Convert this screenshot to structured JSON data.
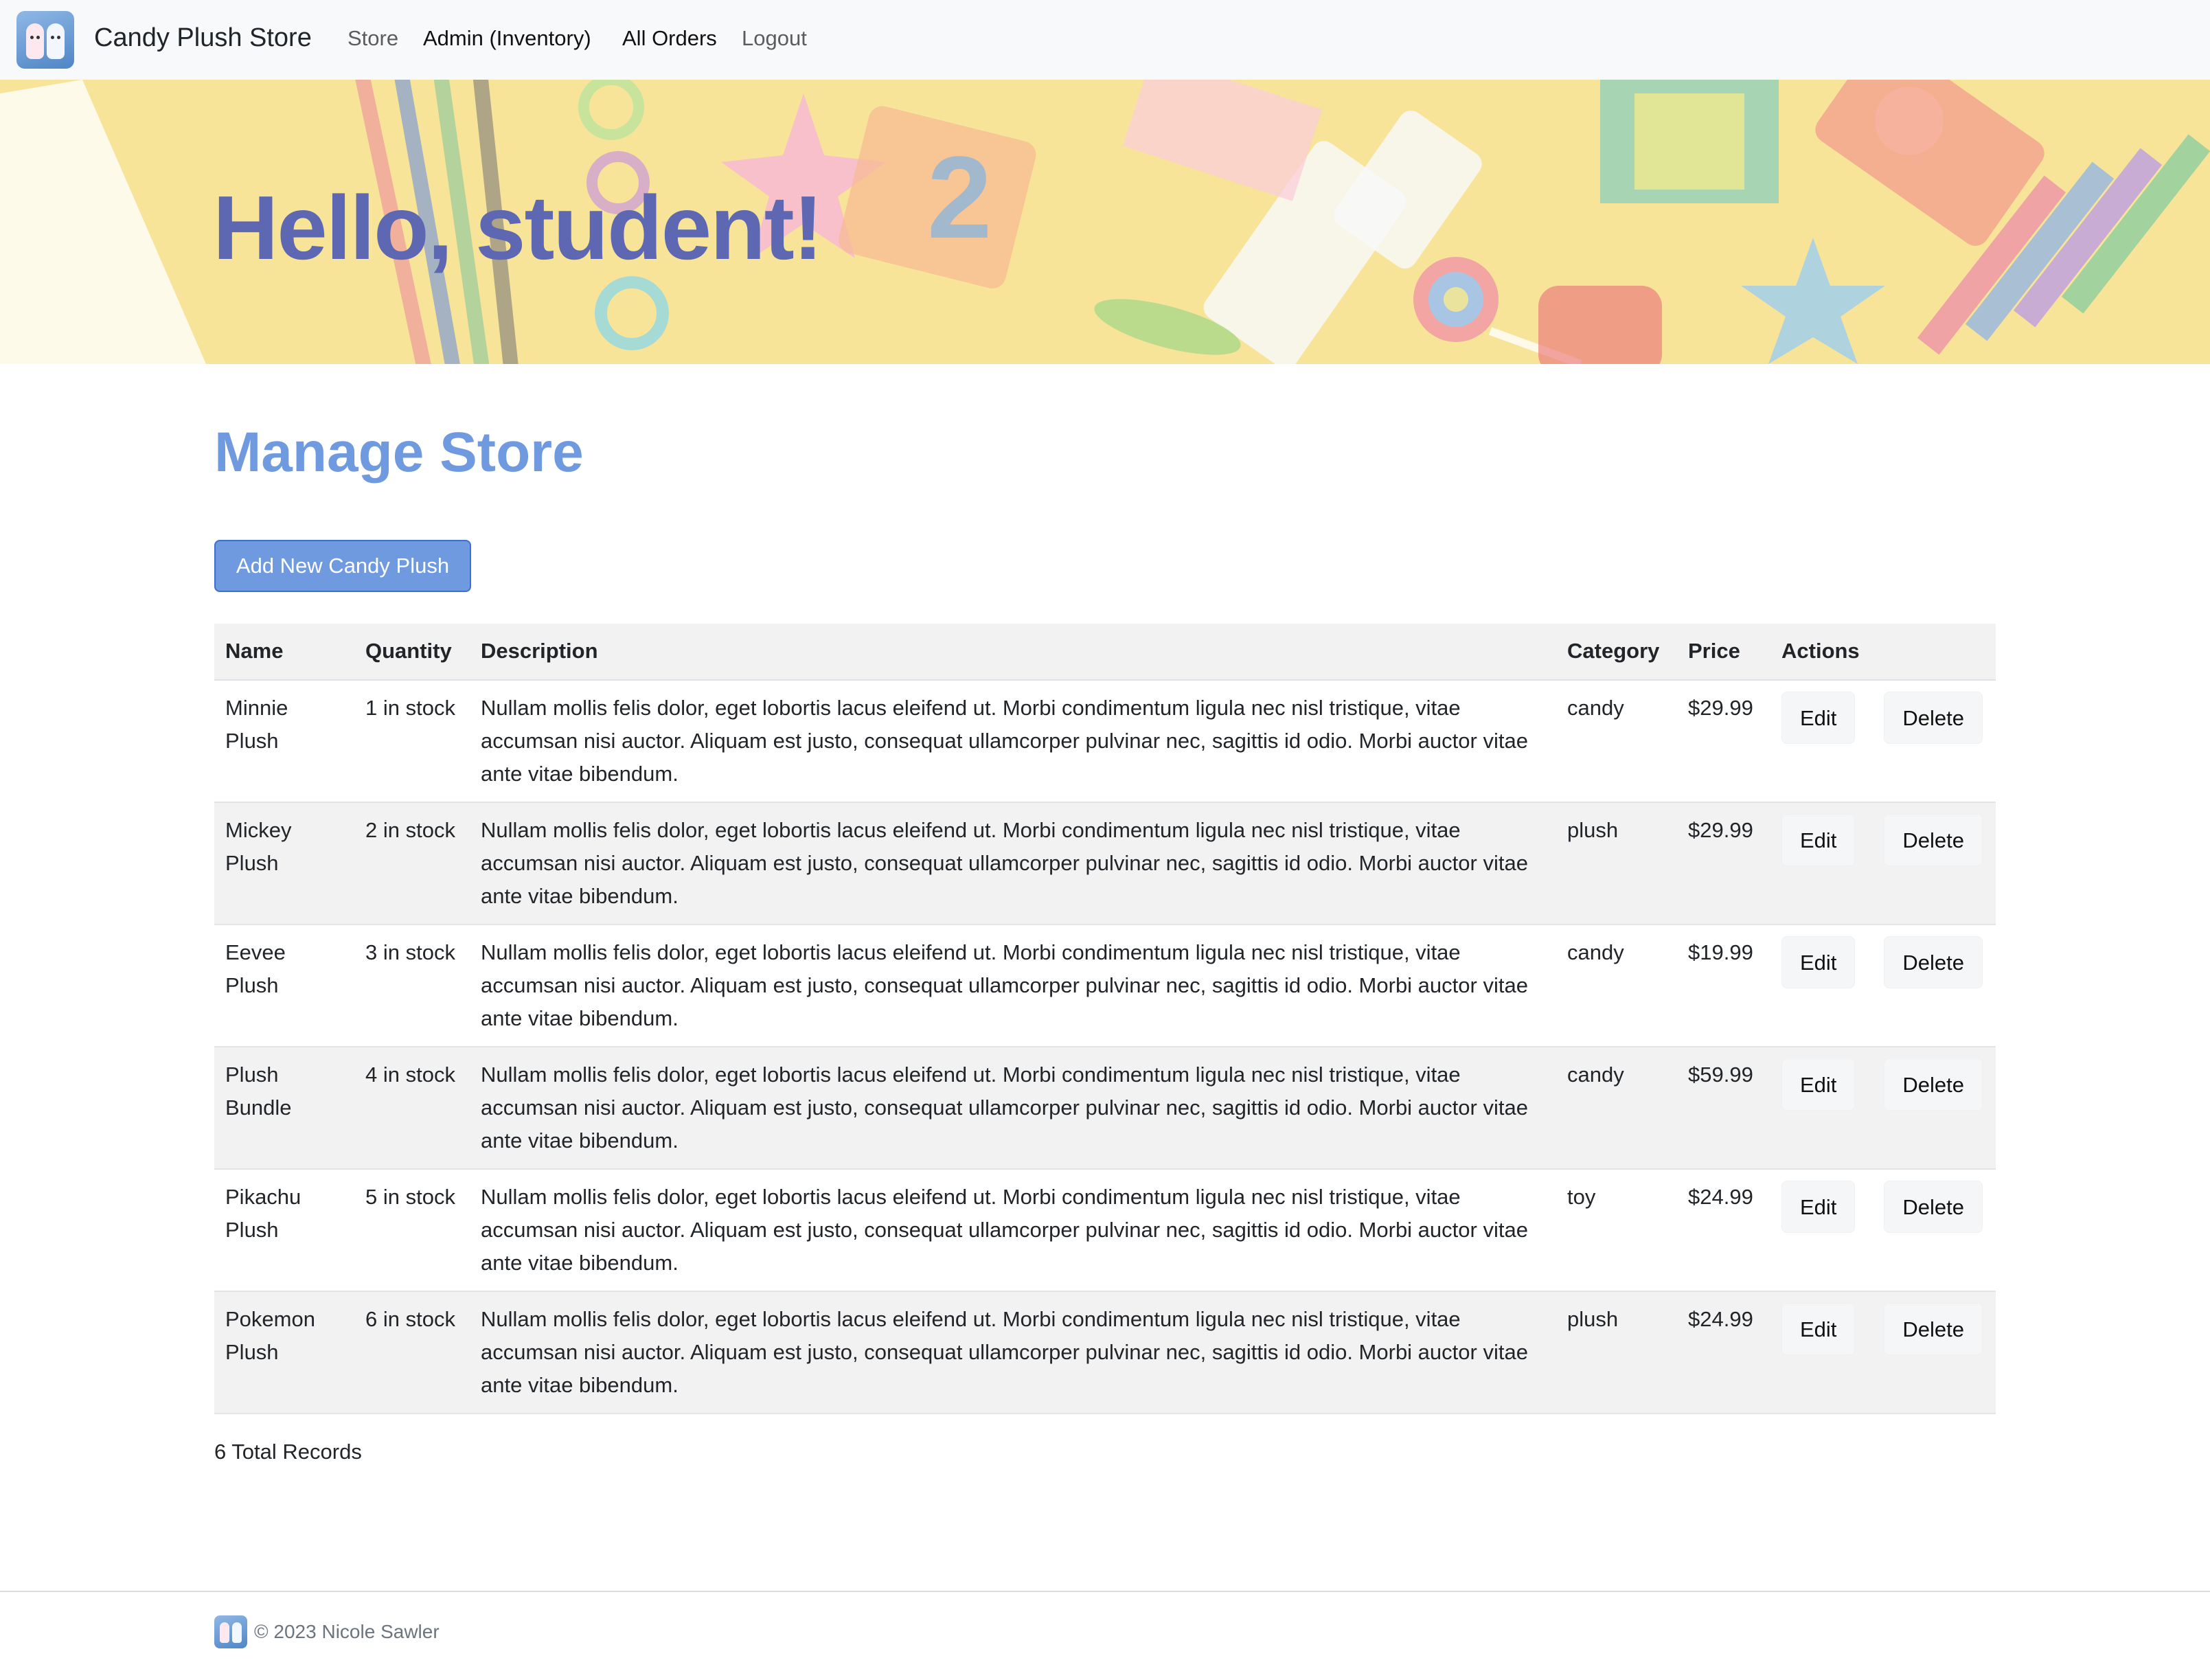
{
  "navbar": {
    "brand": "Candy Plush Store",
    "links": [
      {
        "label": "Store",
        "active": false
      },
      {
        "label": "Admin (Inventory)",
        "active": true
      },
      {
        "label": "All Orders",
        "active": true
      },
      {
        "label": "Logout",
        "active": false
      }
    ]
  },
  "hero": {
    "title": "Hello, student!"
  },
  "main": {
    "page_title": "Manage Store",
    "add_button_label": "Add New Candy Plush",
    "table": {
      "headers": [
        "Name",
        "Quantity",
        "Description",
        "Category",
        "Price",
        "Actions"
      ],
      "rows": [
        {
          "name": "Minnie Plush",
          "quantity": "1 in stock",
          "description": "Nullam mollis felis dolor, eget lobortis lacus eleifend ut. Morbi condimentum ligula nec nisl tristique, vitae accumsan nisi auctor. Aliquam est justo, consequat ullamcorper pulvinar nec, sagittis id odio. Morbi auctor vitae ante vitae bibendum.",
          "category": "candy",
          "price": "$29.99",
          "edit": "Edit",
          "delete": "Delete"
        },
        {
          "name": "Mickey Plush",
          "quantity": "2 in stock",
          "description": "Nullam mollis felis dolor, eget lobortis lacus eleifend ut. Morbi condimentum ligula nec nisl tristique, vitae accumsan nisi auctor. Aliquam est justo, consequat ullamcorper pulvinar nec, sagittis id odio. Morbi auctor vitae ante vitae bibendum.",
          "category": "plush",
          "price": "$29.99",
          "edit": "Edit",
          "delete": "Delete"
        },
        {
          "name": "Eevee Plush",
          "quantity": "3 in stock",
          "description": "Nullam mollis felis dolor, eget lobortis lacus eleifend ut. Morbi condimentum ligula nec nisl tristique, vitae accumsan nisi auctor. Aliquam est justo, consequat ullamcorper pulvinar nec, sagittis id odio. Morbi auctor vitae ante vitae bibendum.",
          "category": "candy",
          "price": "$19.99",
          "edit": "Edit",
          "delete": "Delete"
        },
        {
          "name": "Plush Bundle",
          "quantity": "4 in stock",
          "description": "Nullam mollis felis dolor, eget lobortis lacus eleifend ut. Morbi condimentum ligula nec nisl tristique, vitae accumsan nisi auctor. Aliquam est justo, consequat ullamcorper pulvinar nec, sagittis id odio. Morbi auctor vitae ante vitae bibendum.",
          "category": "candy",
          "price": "$59.99",
          "edit": "Edit",
          "delete": "Delete"
        },
        {
          "name": "Pikachu Plush",
          "quantity": "5 in stock",
          "description": "Nullam mollis felis dolor, eget lobortis lacus eleifend ut. Morbi condimentum ligula nec nisl tristique, vitae accumsan nisi auctor. Aliquam est justo, consequat ullamcorper pulvinar nec, sagittis id odio. Morbi auctor vitae ante vitae bibendum.",
          "category": "toy",
          "price": "$24.99",
          "edit": "Edit",
          "delete": "Delete"
        },
        {
          "name": "Pokemon Plush",
          "quantity": "6 in stock",
          "description": "Nullam mollis felis dolor, eget lobortis lacus eleifend ut. Morbi condimentum ligula nec nisl tristique, vitae accumsan nisi auctor. Aliquam est justo, consequat ullamcorper pulvinar nec, sagittis id odio. Morbi auctor vitae ante vitae bibendum.",
          "category": "plush",
          "price": "$24.99",
          "edit": "Edit",
          "delete": "Delete"
        }
      ]
    },
    "total_records": "6 Total Records"
  },
  "footer": {
    "text": "© 2023 Nicole Sawler"
  },
  "colors": {
    "accent": "#6f9ae0",
    "hero_title": "#5e68b2",
    "hero_background": "#f5d662",
    "navbar_background": "#f8f9fa"
  },
  "icons": [
    "brand-logo-icon",
    "footer-logo-icon"
  ]
}
